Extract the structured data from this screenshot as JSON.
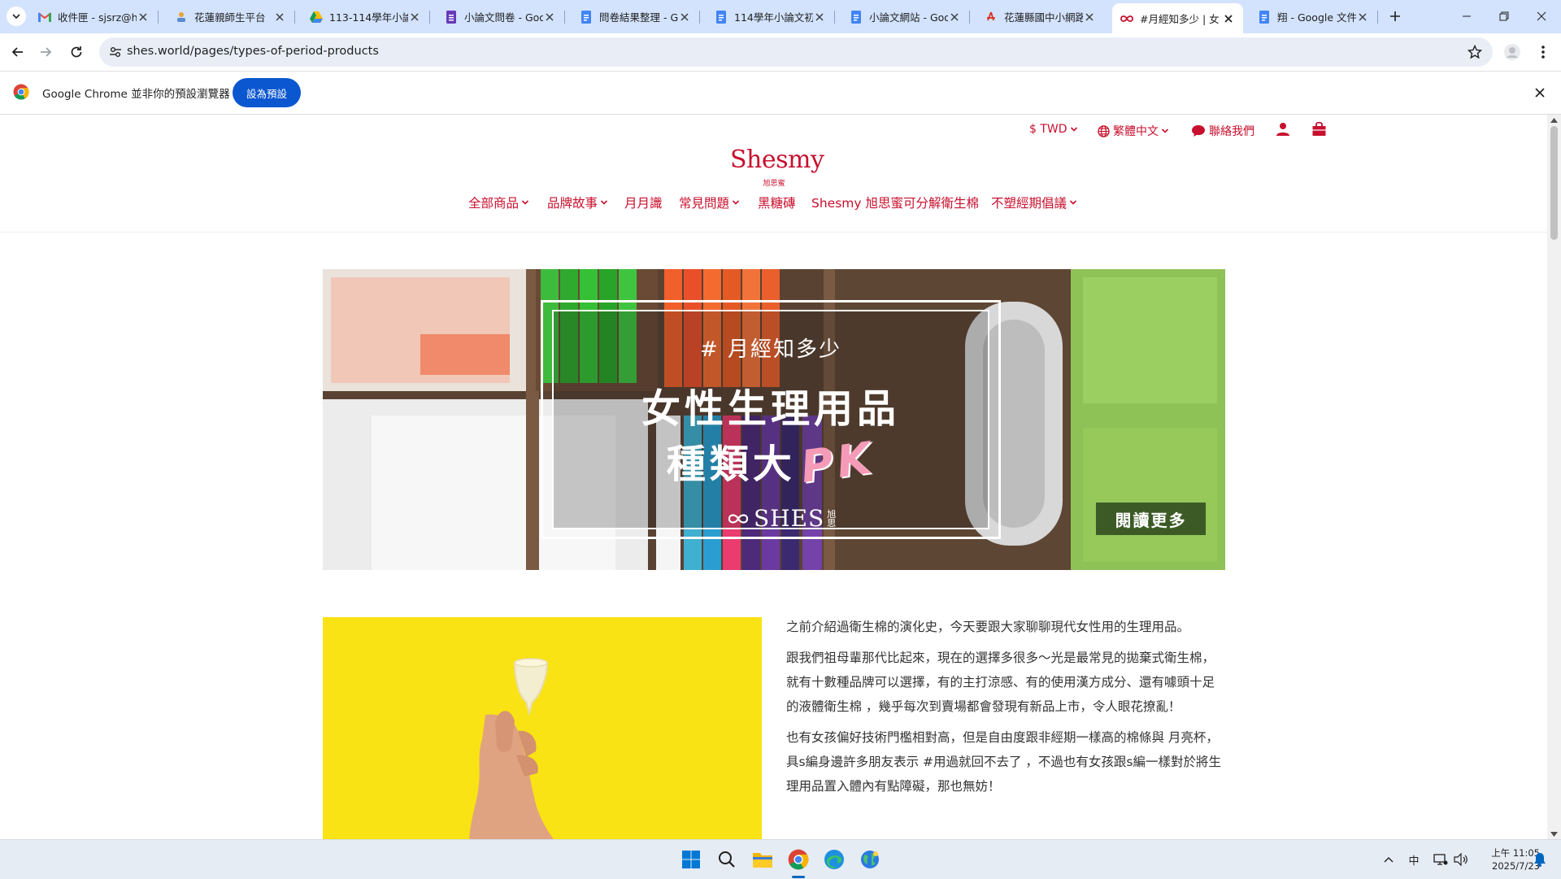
{
  "browser": {
    "tabs": [
      {
        "title": "收件匣 - sjsrz@hl",
        "icon": "gmail-icon"
      },
      {
        "title": "花蓮親師生平台",
        "icon": "teacher-platform-icon"
      },
      {
        "title": "113-114學年小論",
        "icon": "google-drive-icon"
      },
      {
        "title": "小論文問卷 - Goo",
        "icon": "google-forms-icon"
      },
      {
        "title": "問卷結果整理 - G",
        "icon": "google-docs-icon"
      },
      {
        "title": "114學年小論文初",
        "icon": "google-docs-icon"
      },
      {
        "title": "小論文網站 - Goo",
        "icon": "google-docs-icon"
      },
      {
        "title": "花蓮縣國中小網路",
        "icon": "adobe-acrobat-icon"
      },
      {
        "title": "#月經知多少 | 女",
        "icon": "shes-infinity-icon",
        "active": true
      },
      {
        "title": "翔 - Google 文件",
        "icon": "google-docs-icon"
      }
    ],
    "url": "shes.world/pages/types-of-period-products",
    "infobar": {
      "text": "Google Chrome 並非你的預設瀏覽器",
      "button": "設為預設"
    }
  },
  "site": {
    "utility": {
      "currency": "$ TWD",
      "language": "繁體中文",
      "contact": "聯絡我們"
    },
    "logo": "Shesmy",
    "logo_sub": "旭思蜜",
    "nav": [
      {
        "label": "全部商品",
        "dropdown": true
      },
      {
        "label": "品牌故事",
        "dropdown": true
      },
      {
        "label": "月月識",
        "dropdown": false
      },
      {
        "label": "常見問題",
        "dropdown": true
      },
      {
        "label": "黑糖磚",
        "dropdown": false
      },
      {
        "label": "Shesmy 旭思蜜可分解衛生棉",
        "dropdown": false
      },
      {
        "label": "不塑經期倡議",
        "dropdown": true
      }
    ],
    "brand_color": "#c8102e"
  },
  "banner": {
    "tag": "# 月經知多少",
    "title_line1": "女性生理用品",
    "title_line2": "種類大",
    "title_highlight": "PK",
    "brand": "SHES",
    "brand_sub": "旭思",
    "button": "閱讀更多"
  },
  "article": {
    "paragraphs": [
      "之前介紹過衛生棉的演化史，今天要跟大家聊聊現代女性用的生理用品。",
      "跟我們祖母輩那代比起來，現在的選擇多很多～光是最常見的拋棄式衛生棉，就有十數種品牌可以選擇，有的主打涼感、有的使用漢方成分、還有噱頭十足的液體衛生棉 ，幾乎每次到賣場都會發現有新品上市，令人眼花撩亂！",
      "也有女孩偏好技術門檻相對高，但是自由度跟非經期一樣高的棉條與 月亮杯，具s編身邊許多朋友表示 #用過就回不去了 ，不過也有女孩跟s編一樣對於將生理用品置入體內有點障礙，那也無妨！"
    ]
  },
  "taskbar": {
    "clock_time": "上午 11:05",
    "clock_date": "2025/7/23",
    "ime": "中"
  }
}
